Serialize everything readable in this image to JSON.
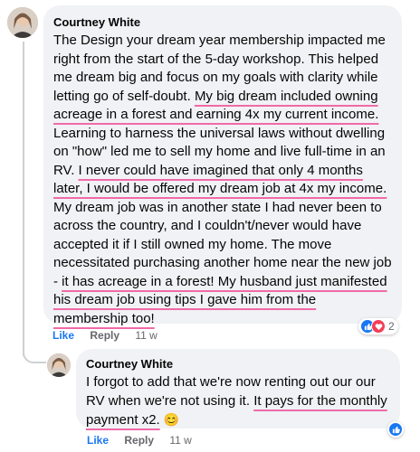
{
  "comment": {
    "author": "Courtney White",
    "text_parts": [
      "The Design your dream year membership impacted me right from the start of the 5-day workshop. This helped me dream big and focus on my goals with clarity while letting go of self-doubt. ",
      "My big dream included owning acreage in a forest and earning 4x my current income.",
      " Learning to harness the universal laws without dwelling on \"how\" led me to sell my home and live full-time in an RV. ",
      "I never could have imagined that only 4 months later, I would be offered my dream job at 4x my income.",
      " My dream job was in another state I had never been to across the country, and I couldn't/never would have accepted it if I still owned my home. The move necessitated purchasing another home near the new job - ",
      "it has acreage in a forest! My husband just manifested his dream job using tips I gave him from the membership too!"
    ],
    "actions": {
      "like": "Like",
      "reply": "Reply",
      "time": "11 w"
    },
    "reaction_count": "2"
  },
  "reply": {
    "author": "Courtney White",
    "text_parts": [
      "I forgot to add that we're now renting out our our RV when we're not using it. ",
      "It pays for the monthly payment x2.",
      " "
    ],
    "emoji": "😊",
    "actions": {
      "like": "Like",
      "reply": "Reply",
      "time": "11 w"
    }
  },
  "colors": {
    "like_blue": "#1877f2",
    "love_red": "#f33e58",
    "highlight_pink": "#f06aa7",
    "bubble_bg": "#f0f2f5"
  },
  "icons": [
    "avatar",
    "like-reaction-icon",
    "love-reaction-icon"
  ]
}
